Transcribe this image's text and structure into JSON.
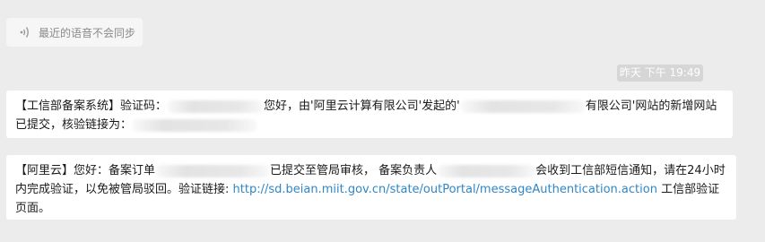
{
  "voice_message": {
    "label": "最近的语音不会同步"
  },
  "timestamp": "昨天 下午 19:49",
  "messages": [
    {
      "part1": "【工信部备案系统】验证码：",
      "part2": "您好，由'阿里云计算有限公司'发起的'",
      "part3": "有限公司'网站的新增网站已提交，核验链接为："
    },
    {
      "part1": "【阿里云】您好：备案订单",
      "part2": "已提交至管局审核， 备案负责人",
      "part3": "会收到工信部短信通知，请在24小时内完成验证，以免被管局驳回。验证链接: ",
      "link": "http://sd.beian.miit.gov.cn/state/outPortal/messageAuthentication.action",
      "part4": " 工信部验证页面。"
    }
  ]
}
